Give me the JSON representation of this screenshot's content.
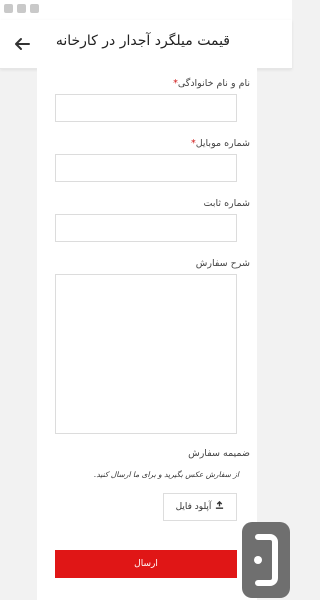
{
  "header": {
    "title": "قیمت میلگرد آجدار در کارخانه",
    "back_icon": "arrow-back-icon"
  },
  "form": {
    "fields": [
      {
        "label": "نام و نام خانوادگی",
        "required": true,
        "value": ""
      },
      {
        "label": "شماره موبایل",
        "required": true,
        "value": ""
      },
      {
        "label": "شماره ثابت",
        "required": false,
        "value": ""
      },
      {
        "label": "شرح سفارش",
        "required": false,
        "value": ""
      }
    ],
    "attachment": {
      "label": "ضمیمه سفارش",
      "hint": "از سفارش عکس بگیرید و برای ما ارسال کنید.",
      "upload_button": "آپلود فایل",
      "upload_icon": "upload-icon"
    },
    "required_mark": "*",
    "submit_label": "ارسال"
  },
  "colors": {
    "accent": "#e01616",
    "required": "#d01818"
  }
}
